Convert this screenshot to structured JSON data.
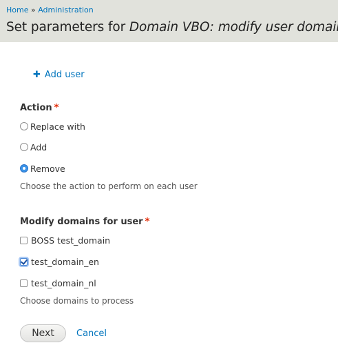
{
  "breadcrumb": {
    "home": "Home",
    "separator": "»",
    "admin": "Administration"
  },
  "page_title": {
    "prefix": "Set parameters for ",
    "name": "Domain VBO: modify user domains"
  },
  "add_user": {
    "icon": "plus-icon",
    "label": "Add user"
  },
  "action": {
    "label": "Action",
    "required": "*",
    "options": [
      {
        "label": "Replace with",
        "selected": false
      },
      {
        "label": "Add",
        "selected": false
      },
      {
        "label": "Remove",
        "selected": true
      }
    ],
    "description": "Choose the action to perform on each user"
  },
  "domains": {
    "label": "Modify domains for user",
    "required": "*",
    "options": [
      {
        "label": "BOSS test_domain",
        "checked": false
      },
      {
        "label": "test_domain_en",
        "checked": true
      },
      {
        "label": "test_domain_nl",
        "checked": false
      }
    ],
    "description": "Choose domains to process"
  },
  "buttons": {
    "next": "Next",
    "cancel": "Cancel"
  },
  "colors": {
    "link": "#0074bd",
    "required": "#e32700",
    "header_bg": "#e1e2dc",
    "radio_selected": "#3b94e8"
  }
}
